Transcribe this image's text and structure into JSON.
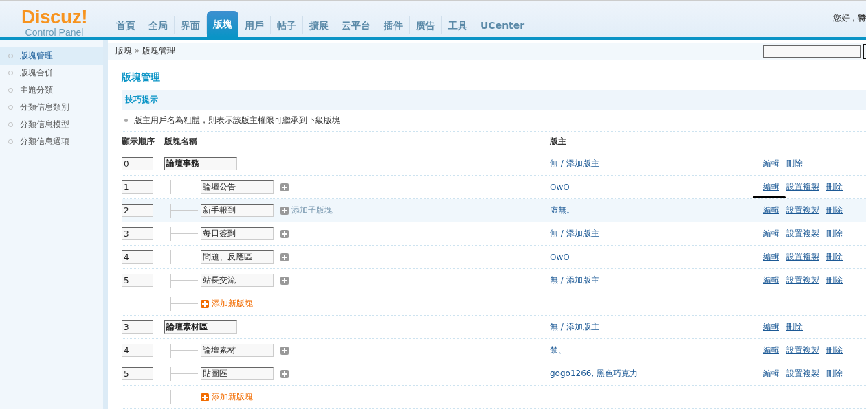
{
  "logo": {
    "name": "Discuz!",
    "subtitle": "Control Panel"
  },
  "nav_tabs": [
    {
      "label": "首頁",
      "selected": false
    },
    {
      "label": "全局",
      "selected": false
    },
    {
      "label": "界面",
      "selected": false
    },
    {
      "label": "版塊",
      "selected": true
    },
    {
      "label": "用戶",
      "selected": false
    },
    {
      "label": "帖子",
      "selected": false
    },
    {
      "label": "擴展",
      "selected": false
    },
    {
      "label": "云平台",
      "selected": false
    },
    {
      "label": "插件",
      "selected": false
    },
    {
      "label": "廣告",
      "selected": false
    },
    {
      "label": "工具",
      "selected": false
    },
    {
      "label": "UCenter",
      "selected": false
    }
  ],
  "greeting": {
    "text": "您好，",
    "user": "特"
  },
  "breadcrumb": {
    "parent": "版塊",
    "separator": "»",
    "current": "版塊管理"
  },
  "sidebar": {
    "items": [
      {
        "label": "版塊管理",
        "selected": true
      },
      {
        "label": "版塊合併",
        "selected": false
      },
      {
        "label": "主題分類",
        "selected": false
      },
      {
        "label": "分類信息類別",
        "selected": false
      },
      {
        "label": "分類信息模型",
        "selected": false
      },
      {
        "label": "分類信息選項",
        "selected": false
      }
    ]
  },
  "page_title": "版塊管理",
  "tips": {
    "title": "技巧提示",
    "items": [
      "版主用戶名為粗體，則表示該版主權限可繼承到下級版塊"
    ]
  },
  "table": {
    "columns": [
      "顯示順序",
      "版塊名稱",
      "版主"
    ],
    "rows": [
      {
        "kind": "group",
        "order": "0",
        "name": "論壇事務",
        "moderators": "無 / 添加版主",
        "actions": [
          "編輯",
          "刪除"
        ]
      },
      {
        "kind": "forum",
        "order": "1",
        "name": "論壇公告",
        "moderators": "OwO",
        "actions": [
          "編輯",
          "設置複製",
          "刪除"
        ],
        "marked": true
      },
      {
        "kind": "forum",
        "order": "2",
        "name": "新手報到",
        "moderators": "虛無。",
        "actions": [
          "編輯",
          "設置複製",
          "刪除"
        ],
        "hovered": true,
        "add_child": "添加子版塊"
      },
      {
        "kind": "forum",
        "order": "3",
        "name": "每日簽到",
        "moderators": "無 / 添加版主",
        "actions": [
          "編輯",
          "設置複製",
          "刪除"
        ]
      },
      {
        "kind": "forum",
        "order": "4",
        "name": "問題、反應區",
        "moderators": "OwO",
        "actions": [
          "編輯",
          "設置複製",
          "刪除"
        ]
      },
      {
        "kind": "forum",
        "order": "5",
        "name": "站長交流",
        "moderators": "無 / 添加版主",
        "actions": [
          "編輯",
          "設置複製",
          "刪除"
        ]
      },
      {
        "kind": "add",
        "label": "添加新版塊"
      },
      {
        "kind": "group",
        "order": "3",
        "name": "論壇素材區",
        "moderators": "無 / 添加版主",
        "actions": [
          "編輯",
          "刪除"
        ]
      },
      {
        "kind": "forum",
        "order": "4",
        "name": "論壇素材",
        "moderators": "禁、",
        "actions": [
          "編輯",
          "設置複製",
          "刪除"
        ]
      },
      {
        "kind": "forum",
        "order": "5",
        "name": "貼圖區",
        "moderators": "gogo1266, 黑色巧克力",
        "actions": [
          "編輯",
          "設置複製",
          "刪除"
        ]
      },
      {
        "kind": "add",
        "label": "添加新版塊"
      }
    ]
  }
}
